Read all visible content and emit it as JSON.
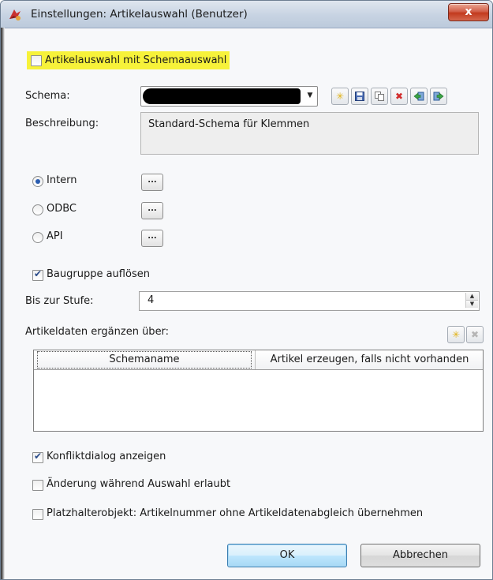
{
  "window": {
    "title": "Einstellungen: Artikelauswahl (Benutzer)",
    "close_glyph": "x"
  },
  "schema_selection": {
    "checkbox_label": "Artikelauswahl mit Schemaauswahl",
    "checked": false,
    "highlight_color": "#f7f23a"
  },
  "schema": {
    "label": "Schema:",
    "value_redacted": true,
    "toolbar": [
      {
        "name": "new-icon",
        "glyph": "✳"
      },
      {
        "name": "save-icon",
        "glyph": "💾"
      },
      {
        "name": "copy-icon",
        "glyph": "⎘"
      },
      {
        "name": "delete-icon",
        "glyph": "✖"
      },
      {
        "name": "import-icon",
        "glyph": "⇲"
      },
      {
        "name": "export-icon",
        "glyph": "⇱"
      }
    ]
  },
  "description": {
    "label": "Beschreibung:",
    "value": "Standard-Schema für Klemmen"
  },
  "source": {
    "options": [
      {
        "label": "Intern",
        "checked": true,
        "button": "..."
      },
      {
        "label": "ODBC",
        "checked": false,
        "button": "..."
      },
      {
        "label": "API",
        "checked": false,
        "button": "..."
      }
    ]
  },
  "assembly": {
    "label": "Baugruppe auflösen",
    "checked": true
  },
  "level": {
    "label": "Bis zur Stufe:",
    "value": "4"
  },
  "supplement": {
    "label": "Artikeldaten ergänzen über:",
    "columns": [
      "Schemaname",
      "Artikel erzeugen, falls nicht vorhanden"
    ],
    "rows": []
  },
  "options": [
    {
      "label": "Konfliktdialog anzeigen",
      "checked": true
    },
    {
      "label": "Änderung während Auswahl erlaubt",
      "checked": false
    },
    {
      "label": "Platzhalterobjekt: Artikelnummer ohne Artikeldatenabgleich übernehmen",
      "checked": false
    }
  ],
  "buttons": {
    "ok": "OK",
    "cancel": "Abbrechen"
  }
}
